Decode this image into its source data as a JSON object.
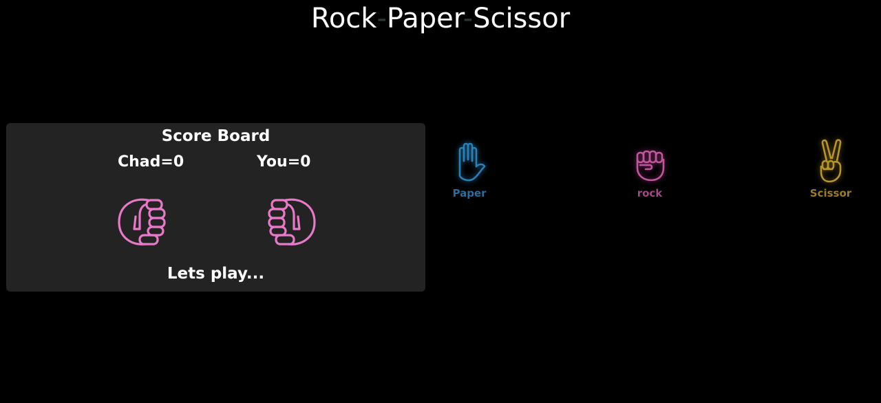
{
  "title": {
    "part1": "Rock",
    "sep": "-",
    "part2": "Paper",
    "part3": "Scissor"
  },
  "scoreboard": {
    "title": "Score Board",
    "chad_label": "Chad=0",
    "you_label": "You=0",
    "status": "Lets play...",
    "chad_hand_icon": "fist-icon",
    "you_hand_icon": "fist-icon"
  },
  "choices": [
    {
      "label": "Paper",
      "icon": "hand-paper-icon",
      "color": "#2a7fb5"
    },
    {
      "label": "rock",
      "icon": "hand-rock-icon",
      "color": "#c0579a"
    },
    {
      "label": "Scissor",
      "icon": "hand-scissor-icon",
      "color": "#b8952a"
    }
  ],
  "colors": {
    "background": "#000000",
    "panel": "#232323",
    "fist": "#e878c8"
  }
}
